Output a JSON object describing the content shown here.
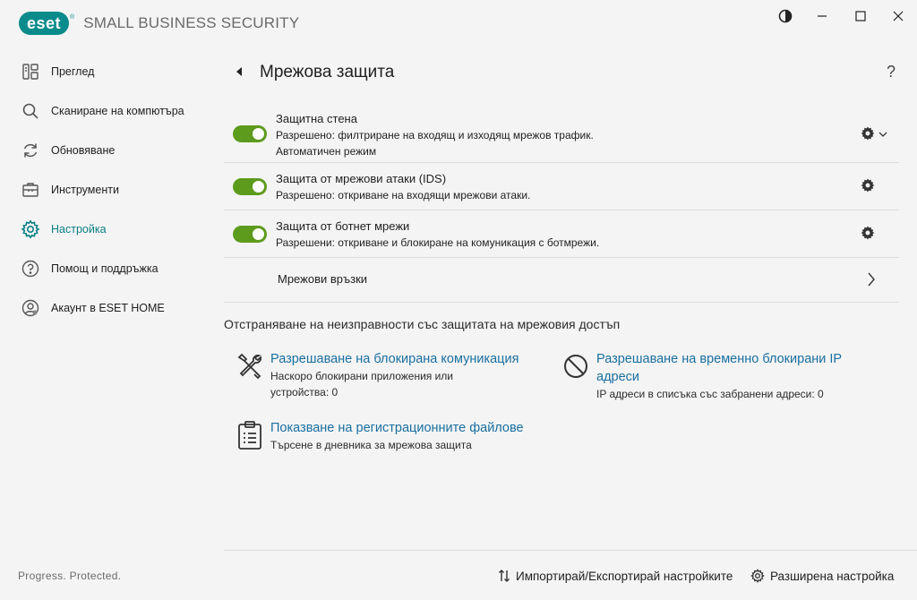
{
  "app": {
    "brand": "eset",
    "product": "SMALL BUSINESS SECURITY",
    "footer": "Progress. Protected."
  },
  "window_controls": {
    "icons": [
      "contrast-icon",
      "minimize-icon",
      "maximize-icon",
      "close-icon"
    ]
  },
  "sidebar": {
    "items": [
      {
        "label": "Преглед",
        "icon": "overview-icon"
      },
      {
        "label": "Сканиране на компютъра",
        "icon": "search-icon"
      },
      {
        "label": "Обновяване",
        "icon": "refresh-icon"
      },
      {
        "label": "Инструменти",
        "icon": "briefcase-icon"
      },
      {
        "label": "Настройка",
        "icon": "gear-icon",
        "active": true
      },
      {
        "label": "Помощ и поддръжка",
        "icon": "help-icon"
      },
      {
        "label": "Акаунт в ESET HOME",
        "icon": "account-icon"
      }
    ]
  },
  "page": {
    "title": "Мрежова защита",
    "help": "?"
  },
  "settings": [
    {
      "title": "Защитна стена",
      "status": "Разрешено:",
      "desc": " филтриране на входящ и изходящ мрежов трафик.",
      "extra": "Автоматичен режим",
      "enabled": true
    },
    {
      "title": "Защита от мрежови атаки (IDS)",
      "status": "Разрешено:",
      "desc": " откриване на входящи мрежови атаки.",
      "enabled": true
    },
    {
      "title": "Защита от ботнет мрежи",
      "status": "Разрешени:",
      "desc": " откриване и блокиране на комуникация с ботмрежи.",
      "enabled": true
    }
  ],
  "network_connections": {
    "label": "Мрежови връзки"
  },
  "troubleshooting": {
    "title": "Отстраняване на неизправности със защитата на мрежовия достъп",
    "tools": [
      {
        "link": "Разрешаване на блокирана комуникация",
        "desc1": "Наскоро блокирани приложения или",
        "desc2": "устройства: 0",
        "icon": "tools-icon"
      },
      {
        "link": "Разрешаване на временно блокирани IP",
        "link2": "адреси",
        "desc1": "IP адреси в списъка със забранени адреси: 0",
        "icon": "blocked-icon"
      },
      {
        "link": "Показване на регистрационните файлове",
        "desc1": "Търсене в дневника за мрежова защита",
        "icon": "clipboard-icon"
      }
    ]
  },
  "bottom": {
    "import_export": "Импортирай/Експортирай настройките",
    "advanced": "Разширена настройка"
  },
  "colors": {
    "accent": "#0a8b8b",
    "toggle_on": "#5d9b1d",
    "link": "#1a6fa0"
  }
}
